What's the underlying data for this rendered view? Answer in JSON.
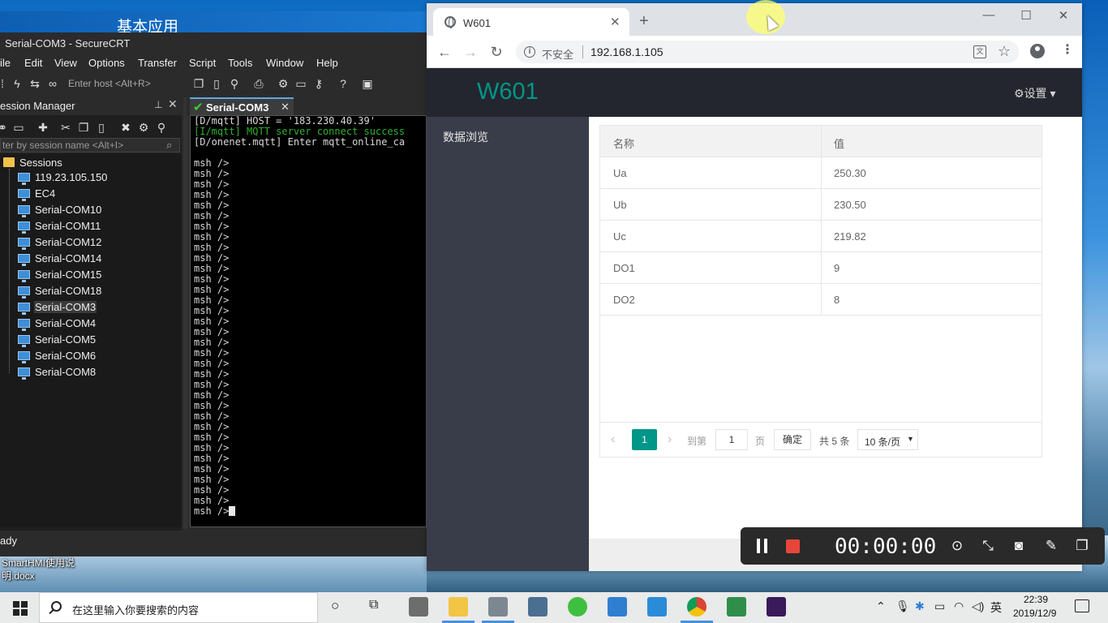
{
  "desktop": {
    "banner_title": "基本应用",
    "file_label": "SmartHMI使用说明.docx"
  },
  "securecrt": {
    "title": "Serial-COM3 - SecureCRT",
    "menu": [
      "ile",
      "Edit",
      "View",
      "Options",
      "Transfer",
      "Script",
      "Tools",
      "Window",
      "Help"
    ],
    "host_placeholder": "Enter host <Alt+R>",
    "session_manager_title": "ession Manager",
    "filter_placeholder": "ter by session name <Alt+I>",
    "root_label": "Sessions",
    "sessions": [
      "119.23.105.150",
      "EC4",
      "Serial-COM10",
      "Serial-COM11",
      "Serial-COM12",
      "Serial-COM14",
      "Serial-COM15",
      "Serial-COM18",
      "Serial-COM3",
      "Serial-COM4",
      "Serial-COM5",
      "Serial-COM6",
      "Serial-COM8"
    ],
    "selected_session": "Serial-COM3",
    "tab_label": "Serial-COM3",
    "terminal": {
      "line1": "[D/mqtt] HOST = '183.230.40.39'",
      "line2": "[I/mqtt] MQTT server connect success",
      "line3": "[D/onenet.mqtt] Enter mqtt_online_ca",
      "prompt": "msh />",
      "prompt_count": 34
    },
    "status": "ady"
  },
  "chrome": {
    "tab_title": "W601",
    "insecure_label": "不安全",
    "url": "192.168.1.105"
  },
  "app": {
    "logo": "W601",
    "settings_label": "设置",
    "side_item": "数据浏览",
    "table": {
      "headers": [
        "名称",
        "值"
      ],
      "rows": [
        {
          "name": "Ua",
          "value": "250.30"
        },
        {
          "name": "Ub",
          "value": "230.50"
        },
        {
          "name": "Uc",
          "value": "219.82"
        },
        {
          "name": "DO1",
          "value": "9"
        },
        {
          "name": "DO2",
          "value": "8"
        }
      ]
    },
    "pager": {
      "current_page": "1",
      "goto_label": "到第",
      "page_input": "1",
      "page_suffix": "页",
      "confirm_label": "确定",
      "total_label": "共 5 条",
      "page_size_label": "10 条/页"
    }
  },
  "recorder": {
    "time": "00:00:00"
  },
  "taskbar": {
    "search_placeholder": "在这里输入你要搜索的内容",
    "ime_label": "英",
    "time": "22:39",
    "date": "2019/12/9"
  }
}
